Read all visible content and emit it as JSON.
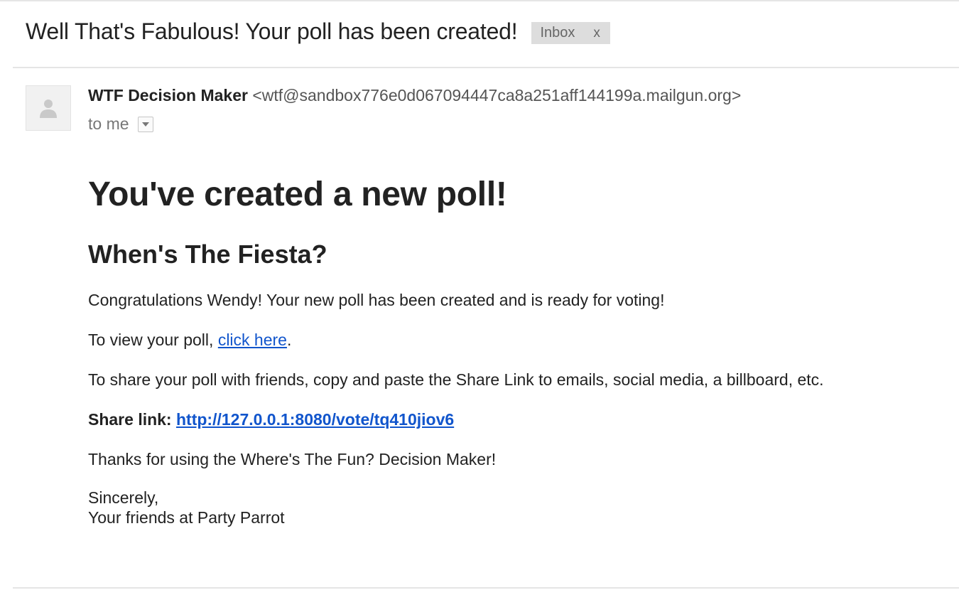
{
  "email": {
    "subject": "Well That's Fabulous! Your poll has been created!",
    "label": "Inbox",
    "label_close": "x",
    "sender_name": "WTF Decision Maker",
    "sender_email": "<wtf@sandbox776e0d067094447ca8a251aff144199a.mailgun.org>",
    "recipient": "to me"
  },
  "body": {
    "heading": "You've created a new poll!",
    "poll_title": "When's The Fiesta?",
    "congrats": "Congratulations Wendy! Your new poll has been created and is ready for voting!",
    "view_prefix": "To view your poll, ",
    "view_link": "click here",
    "view_suffix": ".",
    "share_text": "To share your poll with friends, copy and paste the Share Link to emails, social media, a billboard, etc.",
    "share_label": "Share link:",
    "share_url": "http://127.0.0.1:8080/vote/tq410jiov6",
    "thanks": "Thanks for using the Where's The Fun? Decision Maker!",
    "signoff": "Sincerely,",
    "signature": "Your friends at Party Parrot"
  },
  "icons": {
    "avatar": "person-icon",
    "dropdown": "caret-down-icon"
  },
  "colors": {
    "link": "#1155cc",
    "label_bg": "#dddddd"
  }
}
